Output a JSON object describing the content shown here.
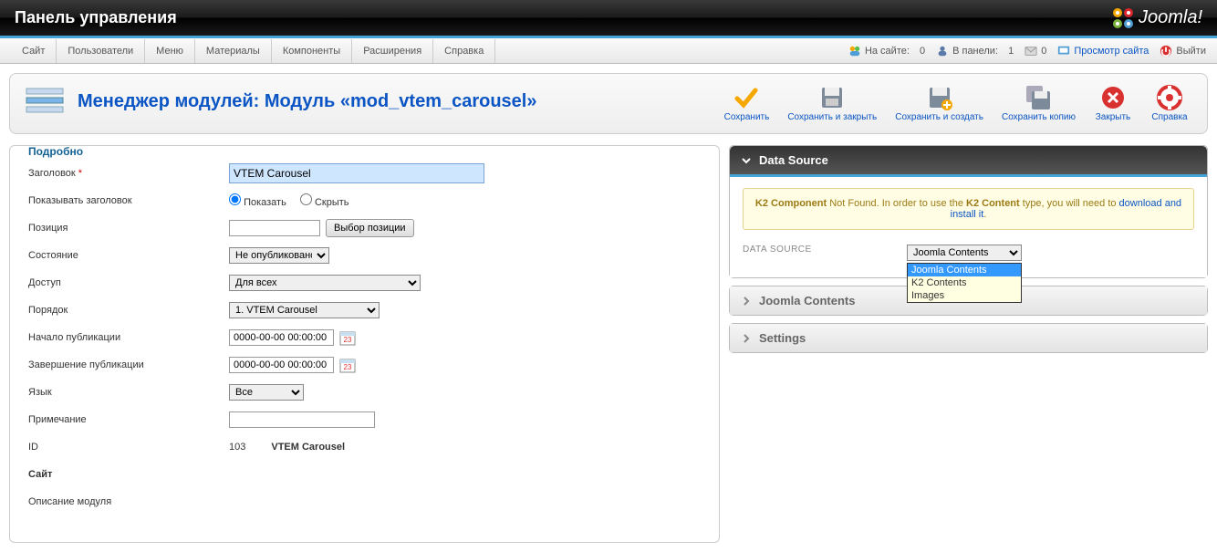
{
  "header": {
    "title": "Панель управления",
    "brand": "Joomla!"
  },
  "menu": {
    "items": [
      "Сайт",
      "Пользователи",
      "Меню",
      "Материалы",
      "Компоненты",
      "Расширения",
      "Справка"
    ]
  },
  "status": {
    "onsite_label": "На сайте:",
    "onsite_value": "0",
    "inpanel_label": "В панели:",
    "inpanel_value": "1",
    "msg_value": "0",
    "preview": "Просмотр сайта",
    "logout": "Выйти"
  },
  "page": {
    "title": "Менеджер модулей: Модуль «mod_vtem_carousel»"
  },
  "toolbar": {
    "save": "Сохранить",
    "save_close": "Сохранить и закрыть",
    "save_new": "Сохранить и создать",
    "save_copy": "Сохранить копию",
    "cancel": "Закрыть",
    "help": "Справка"
  },
  "details": {
    "legend": "Подробно",
    "title_label": "Заголовок",
    "title_value": "VTEM Carousel",
    "showtitle_label": "Показывать заголовок",
    "show": "Показать",
    "hide": "Скрыть",
    "position_label": "Позиция",
    "position_btn": "Выбор позиции",
    "state_label": "Состояние",
    "state_value": "Не опубликовано",
    "access_label": "Доступ",
    "access_value": "Для всех",
    "ordering_label": "Порядок",
    "ordering_value": "1. VTEM Carousel",
    "pubstart_label": "Начало публикации",
    "pubstart_value": "0000-00-00 00:00:00",
    "pubend_label": "Завершение публикации",
    "pubend_value": "0000-00-00 00:00:00",
    "lang_label": "Язык",
    "lang_value": "Все",
    "note_label": "Примечание",
    "id_label": "ID",
    "id_value": "103",
    "id_name": "VTEM Carousel",
    "site_label": "Сайт",
    "desc_label": "Описание модуля"
  },
  "panels": {
    "datasource": {
      "title": "Data Source",
      "notice_strong1": "K2 Component",
      "notice_text1": " Not Found. In order to use the ",
      "notice_strong2": "K2 Content",
      "notice_text2": " type, you will need to ",
      "notice_link": "download and install it",
      "notice_dot": ".",
      "label": "DATA SOURCE",
      "selected": "Joomla Contents",
      "options": [
        "Joomla Contents",
        "K2 Contents",
        "Images"
      ]
    },
    "joomla": {
      "title": "Joomla Contents"
    },
    "settings": {
      "title": "Settings"
    }
  }
}
